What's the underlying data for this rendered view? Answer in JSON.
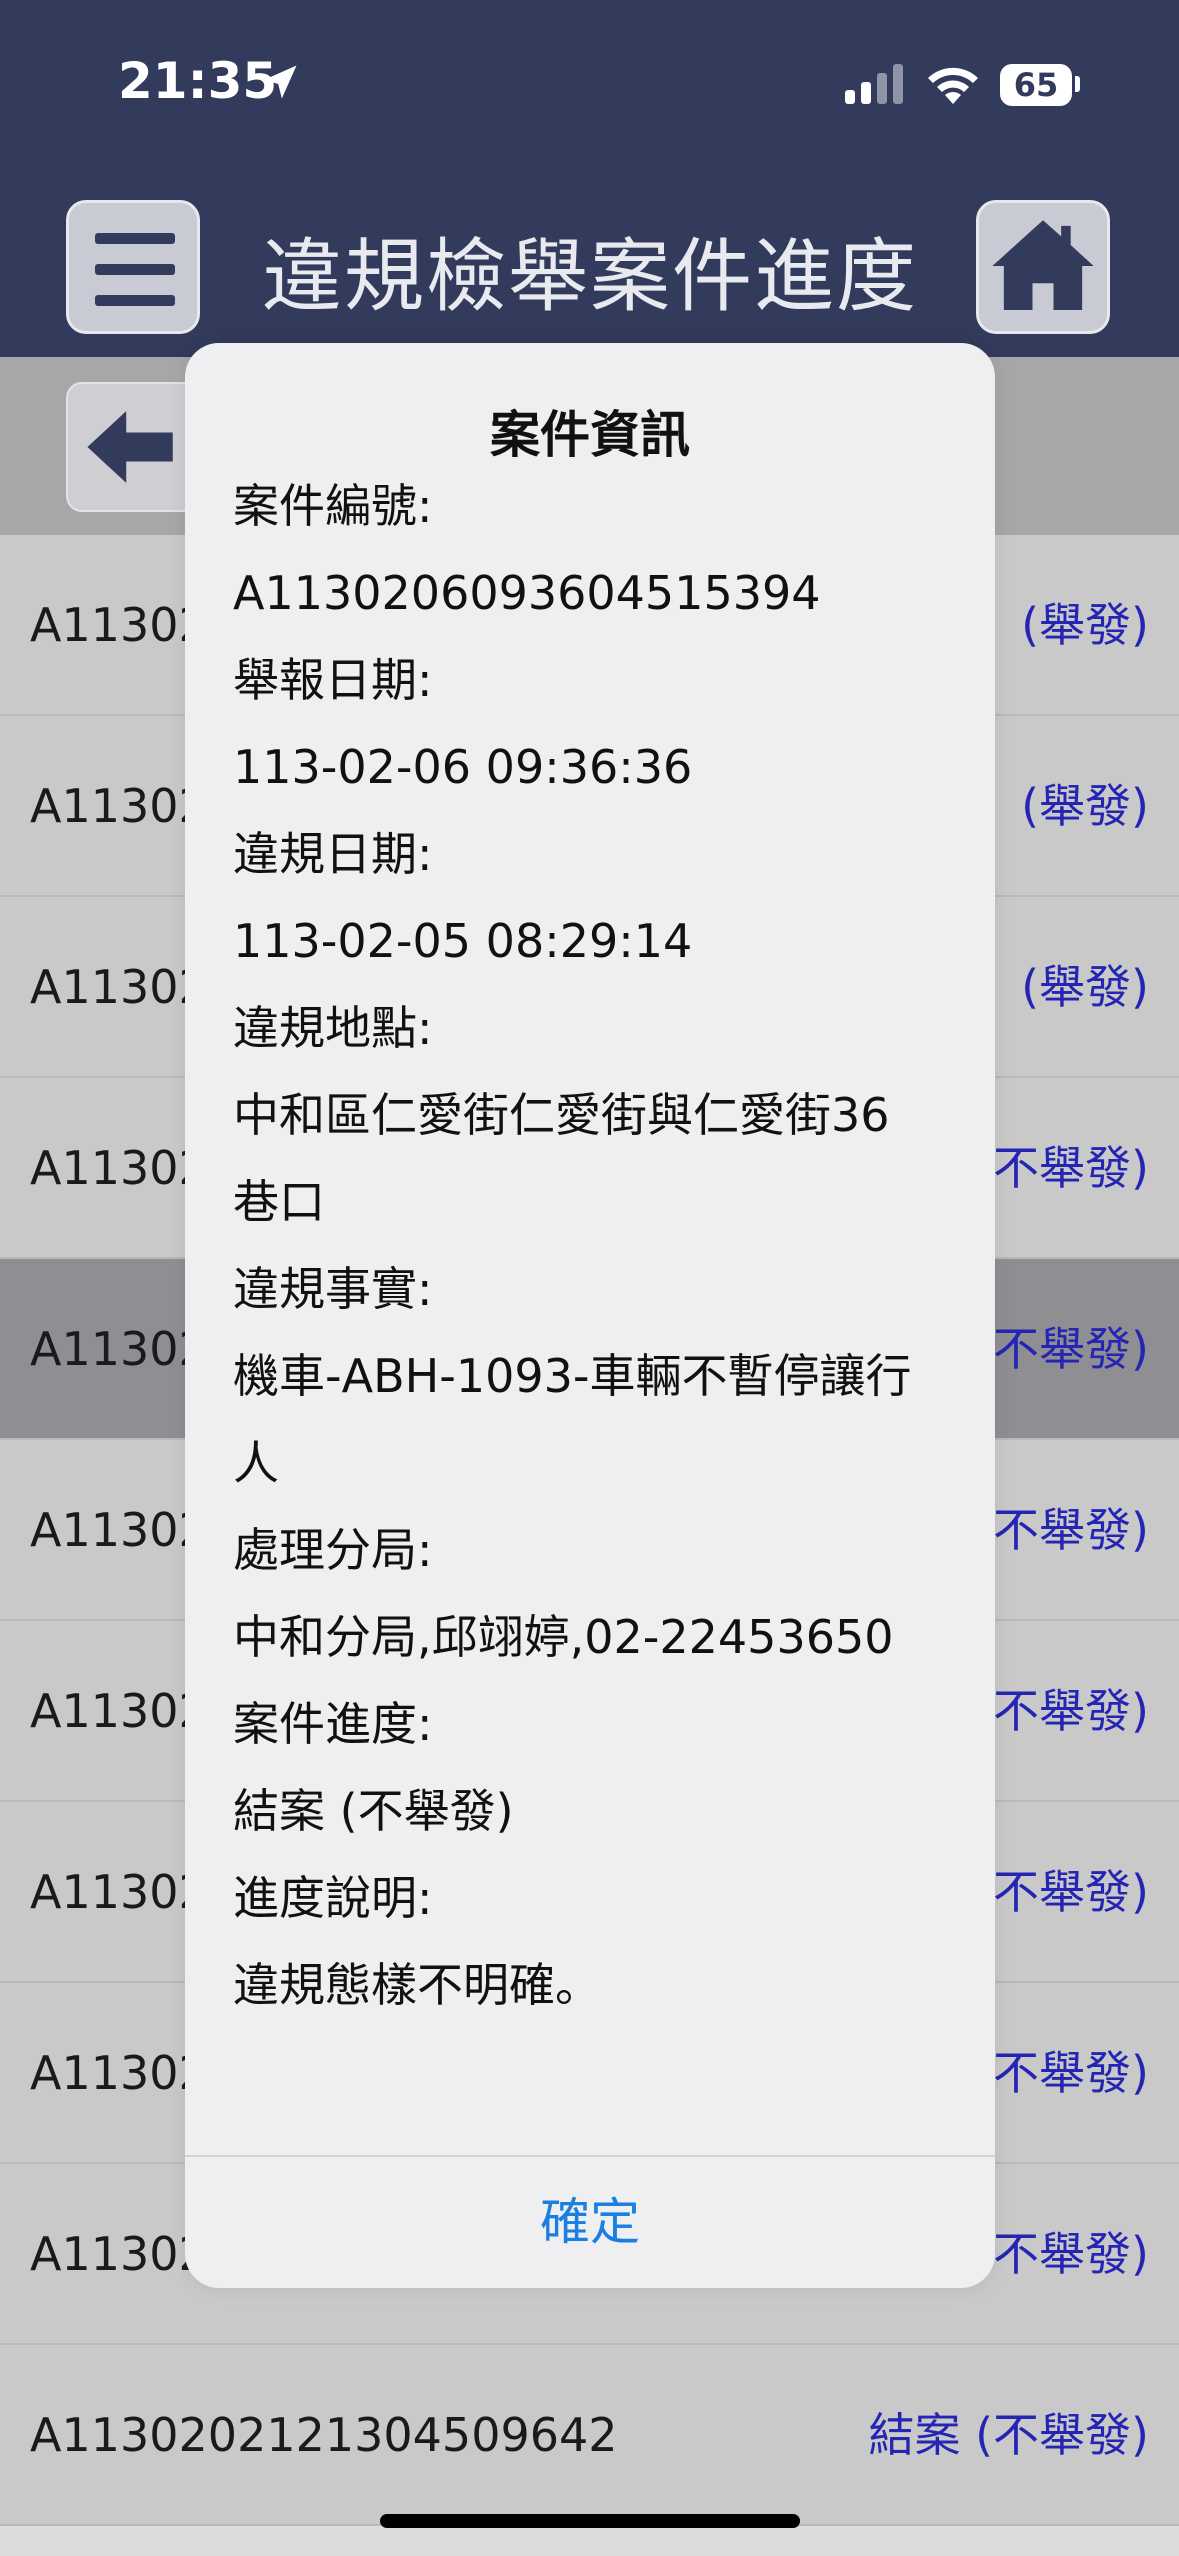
{
  "status_bar": {
    "time": "21:35",
    "battery": "65"
  },
  "header": {
    "title": "違規檢舉案件進度"
  },
  "list": {
    "rows": [
      {
        "id": "A11302",
        "status": "(舉發)"
      },
      {
        "id": "A11302",
        "status": "(舉發)"
      },
      {
        "id": "A11302",
        "status": "(舉發)"
      },
      {
        "id": "A11302",
        "status": "不舉發)"
      },
      {
        "id": "A11302",
        "status": "不舉發)"
      },
      {
        "id": "A11302",
        "status": "不舉發)"
      },
      {
        "id": "A11302",
        "status": "不舉發)"
      },
      {
        "id": "A11302",
        "status": "不舉發)"
      },
      {
        "id": "A11302",
        "status": "不舉發)"
      },
      {
        "id": "A11302",
        "status": "不舉發)"
      },
      {
        "id": "A1130202121304509642",
        "status": "結案 (不舉發)"
      }
    ],
    "selected_index": 4
  },
  "dialog": {
    "title": "案件資訊",
    "lines": [
      "案件編號:",
      "A1130206093604515394",
      "舉報日期:",
      "113-02-06 09:36:36",
      "違規日期:",
      "113-02-05 08:29:14",
      "違規地點:",
      "中和區仁愛街仁愛街與仁愛街36",
      "巷口",
      "違規事實:",
      "機車-ABH-1093-車輛不暫停讓行",
      "人",
      "處理分局:",
      "中和分局,邱翊婷,02-22453650",
      "案件進度:",
      "結案 (不舉發)",
      "進度說明:",
      "違規態樣不明確。"
    ],
    "ok_label": "確定"
  },
  "colors": {
    "header_bg": "#323b5c",
    "link_blue": "#2525b4",
    "ok_blue": "#1a7fe0"
  }
}
